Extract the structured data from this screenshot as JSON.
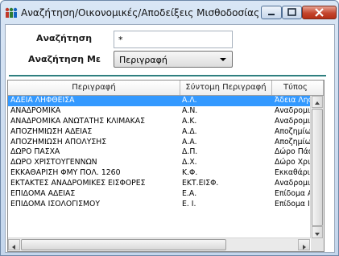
{
  "window": {
    "title": "Αναζήτηση/Οικονομικές/Αποδείξεις Μισθοδοσίας",
    "icon": "people-group-icon",
    "buttons": [
      "minimize",
      "maximize",
      "close"
    ]
  },
  "search": {
    "label": "Αναζήτηση",
    "value": "*"
  },
  "search_by": {
    "label": "Αναζήτηση Με",
    "selected": "Περιγραφή"
  },
  "grid": {
    "columns": [
      "Περιγραφή",
      "Σύντομη Περιγραφή",
      "Τύπος"
    ],
    "selected_row": 0,
    "rows": [
      [
        "ΑΔΕΙΑ ΛΗΦΘΕΙΣΑ",
        "Α.Λ.",
        "Άδεια Ληφθ"
      ],
      [
        "ΑΝΑΔΡΟΜΙΚΑ",
        "Α.Ν.",
        "Αναδρομικό"
      ],
      [
        "ΑΝΑΔΡΟΜΙΚΑ ΑΝΩΤΑΤΗΣ ΚΛΙΜΑΚΑΣ",
        "Α.Κ.",
        "Αναδρομικό"
      ],
      [
        "ΑΠΟΖΗΜΙΩΣΗ ΑΔΕΙΑΣ",
        "Α.Δ.",
        "Αποζημίωσ"
      ],
      [
        "ΑΠΟΖΗΜΙΩΣΗ ΑΠΟΛΥΣΗΣ",
        "Α.Α.",
        "Αποζημίωσ"
      ],
      [
        "ΔΩΡΟ ΠΑΣΧΑ",
        "Δ.Π.",
        "Δώρο Πάσχ"
      ],
      [
        "ΔΩΡΟ ΧΡΙΣΤΟΥΓΕΝΝΩΝ",
        "Δ.Χ.",
        "Δώρο Χριστ"
      ],
      [
        "ΕΚΚΑΘΑΡΙΣΗ ΦΜΥ ΠΟΛ. 1260",
        "Κ.Φ.",
        "Εκκαθάριση"
      ],
      [
        "ΕΚΤΑΚΤΕΣ ΑΝΑΔΡΟΜΙΚΕΣ ΕΙΣΦΟΡΕΣ",
        "ΕΚΤ.ΕΙΣΦ.",
        "Αναδρομικό"
      ],
      [
        "ΕΠΙΔΟΜΑ ΑΔΕΙΑΣ",
        "Ε.Α.",
        "Επίδομα Αδ"
      ],
      [
        "ΕΠΙΔΟΜΑ ΙΣΟΛΟΓΙΣΜΟΥ",
        "Ε. Ι.",
        "Επίδομα Ισο"
      ]
    ]
  }
}
